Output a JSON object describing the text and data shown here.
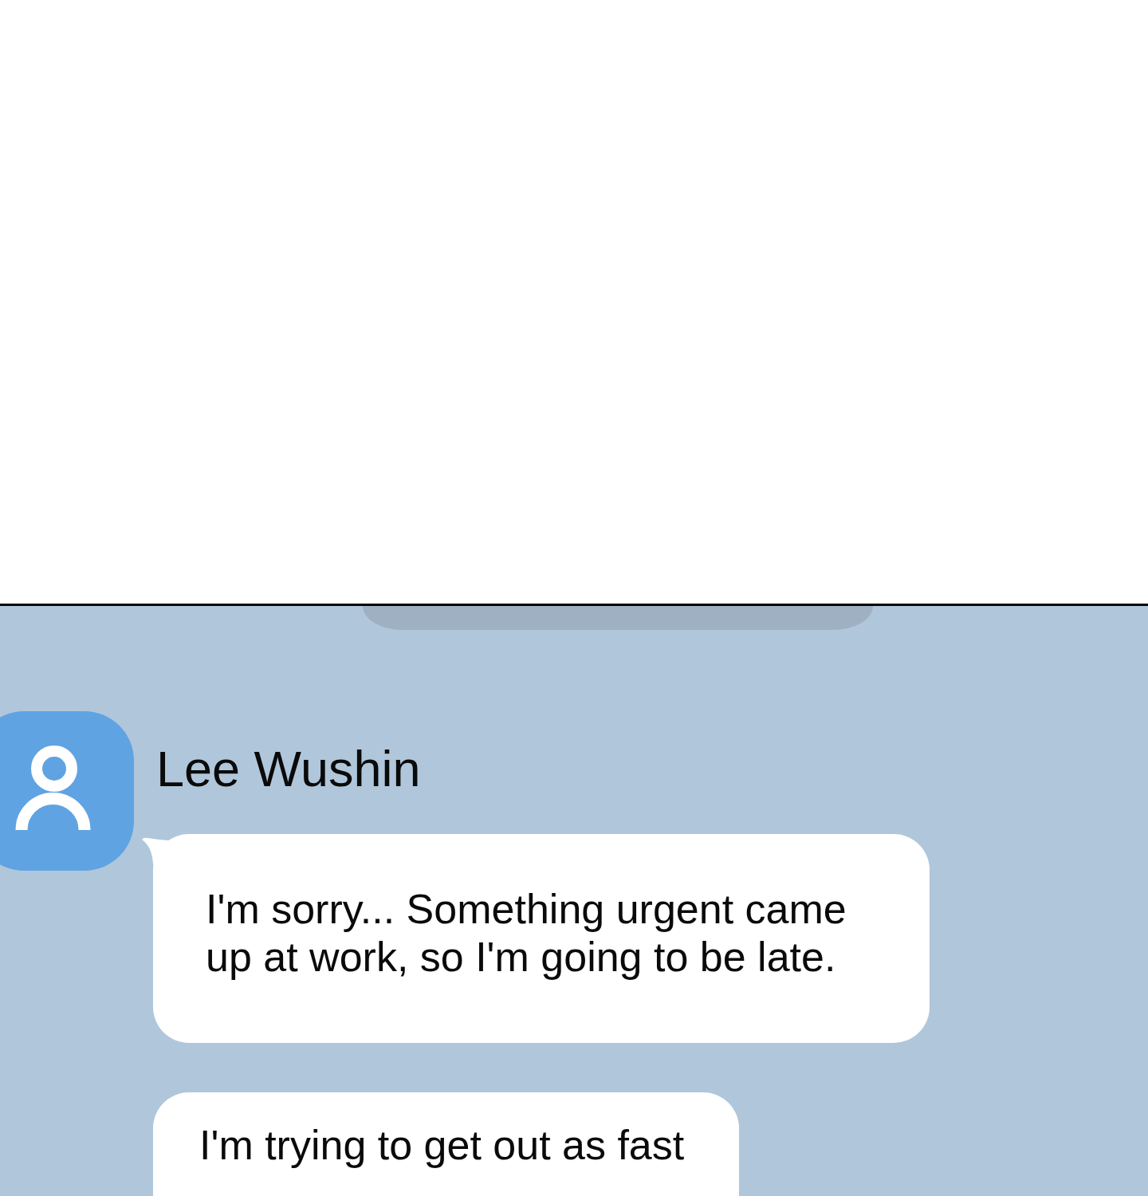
{
  "contact": {
    "name": "Lee Wushin"
  },
  "messages": [
    {
      "text": "I'm sorry... Something urgent came up at work, so I'm going to be late.",
      "tail": true
    },
    {
      "text": "I'm trying to get out as fast",
      "tail": false
    }
  ]
}
